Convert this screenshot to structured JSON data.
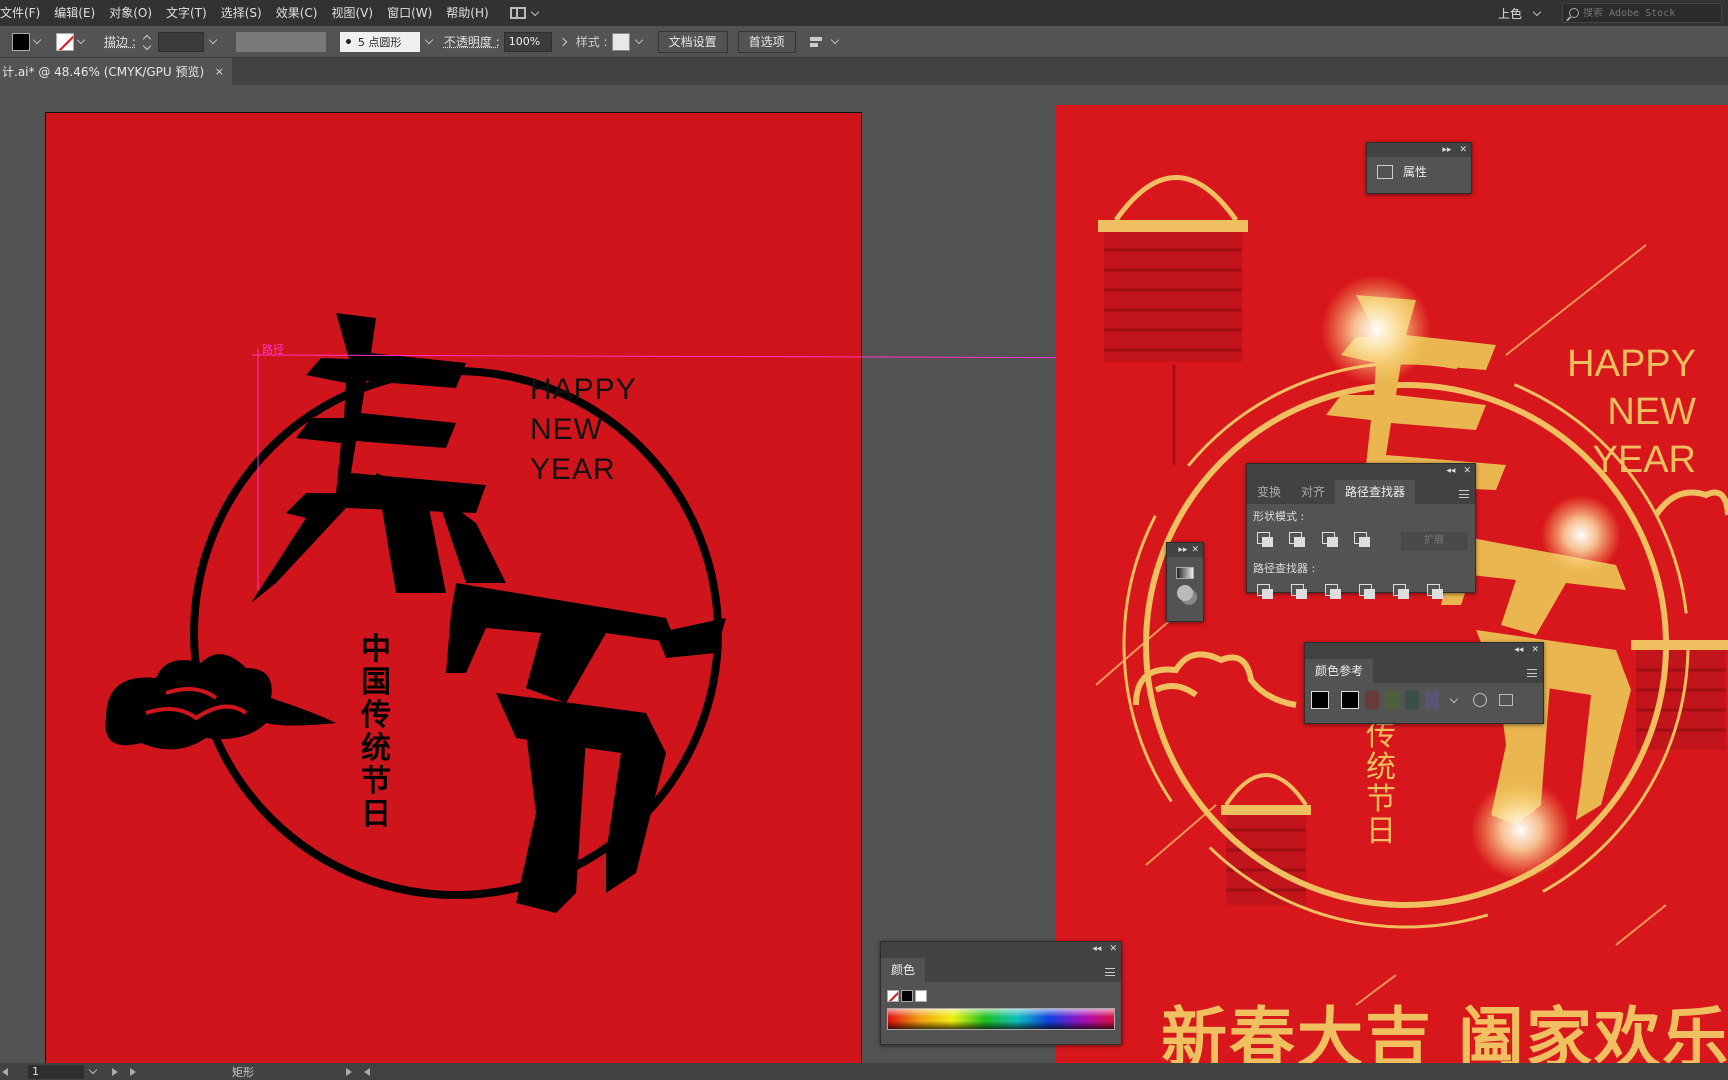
{
  "menubar": {
    "items": [
      "文件(F)",
      "编辑(E)",
      "对象(O)",
      "文字(T)",
      "选择(S)",
      "效果(C)",
      "视图(V)",
      "窗口(W)",
      "帮助(H)"
    ],
    "workspace": "上色",
    "search_placeholder": "搜索 Adobe Stock"
  },
  "control": {
    "stroke_label": "描边 :",
    "brush": "5 点圆形",
    "opacity_label": "不透明度 :",
    "opacity_value": "100%",
    "style_label": "样式 :",
    "doc_setup": "文档设置",
    "preferences": "首选项"
  },
  "document_tab": {
    "title": "计.ai* @ 48.46% (CMYK/GPU 预览)",
    "close": "×"
  },
  "artwork_left": {
    "english": [
      "HAPPY",
      "NEW",
      "YEAR"
    ],
    "calligraphy": [
      "春",
      "节"
    ],
    "vertical_text": "中国传统节日"
  },
  "artwork_right": {
    "english": [
      "HAPPY",
      "NEW",
      "YEAR"
    ],
    "calligraphy": [
      "春",
      "节"
    ],
    "vertical_text": "传统节日",
    "bottom_slogan": "新春大吉 阖家欢乐"
  },
  "guide_label": "路径",
  "panels": {
    "properties": {
      "label": "属性"
    },
    "pathfinder": {
      "tabs": [
        "变换",
        "对齐",
        "路径查找器"
      ],
      "shape_modes": "形状模式 :",
      "pathfinders": "路径查找器 :",
      "expand": "扩展"
    },
    "color_guide": {
      "title": "颜色参考"
    },
    "color": {
      "title": "颜色"
    }
  },
  "status": {
    "artboard_num": "1",
    "tool_name": "矩形"
  },
  "colors": {
    "artboard_red": "#d0141b",
    "gold": "#f0c060",
    "ui_dark": "#323232",
    "ui_mid": "#535353",
    "guide_magenta": "#ff33cc"
  }
}
